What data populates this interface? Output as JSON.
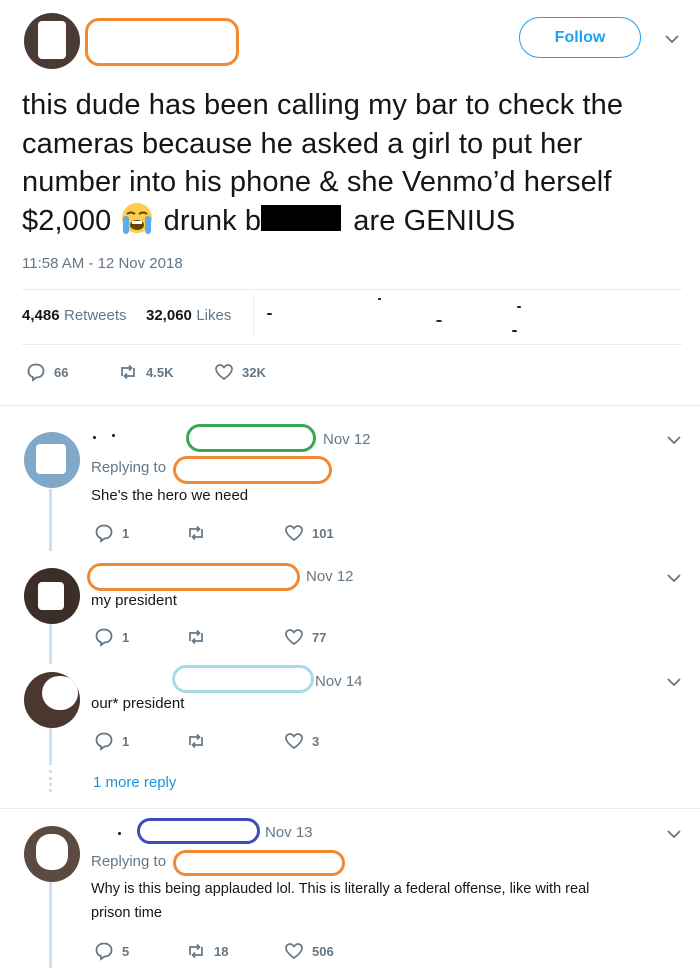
{
  "header": {
    "follow_label": "Follow",
    "chevron_icon": "chevron-down-icon"
  },
  "tweet": {
    "text_part1": "this dude has been calling my bar to check the cameras because he asked a girl to put her number into his phone & she Venmo’d herself $2,000 ",
    "text_part2": " drunk b",
    "text_part3": " are GENIUS",
    "emoji_icon": "loudly-crying-face-icon",
    "timestamp": "11:58 AM - 12 Nov 2018",
    "retweets_count": "4,486",
    "retweets_label": "Retweets",
    "likes_count": "32,060",
    "likes_label": "Likes",
    "actions": {
      "reply": "66",
      "retweet": "4.5K",
      "like": "32K"
    }
  },
  "replies": [
    {
      "date": "Nov 12",
      "replying_to": "Replying to",
      "text": "She's the hero we need",
      "reply_count": "1",
      "retweet_count": "",
      "like_count": "101",
      "redact_color": "#3aa757"
    },
    {
      "date": "Nov 12",
      "text": "my president",
      "reply_count": "1",
      "retweet_count": "",
      "like_count": "77",
      "redact_color": "#f08a34"
    },
    {
      "date": "Nov 14",
      "text": "our* president",
      "reply_count": "1",
      "retweet_count": "",
      "like_count": "3",
      "redact_color": "#a6dcea"
    },
    {
      "date": "Nov 13",
      "replying_to": "Replying to",
      "text_line1": "Why is this being applauded lol. This is literally a federal offense, like with real",
      "text_line2": "prison time",
      "reply_count": "5",
      "retweet_count": "18",
      "like_count": "506",
      "redact_color": "#3c4cb8"
    }
  ],
  "more_reply": "1 more reply",
  "colors": {
    "accent": "#1da1f2",
    "redact_orange": "#f08a34",
    "thread_line": "#cce0f5",
    "muted": "#657786"
  }
}
